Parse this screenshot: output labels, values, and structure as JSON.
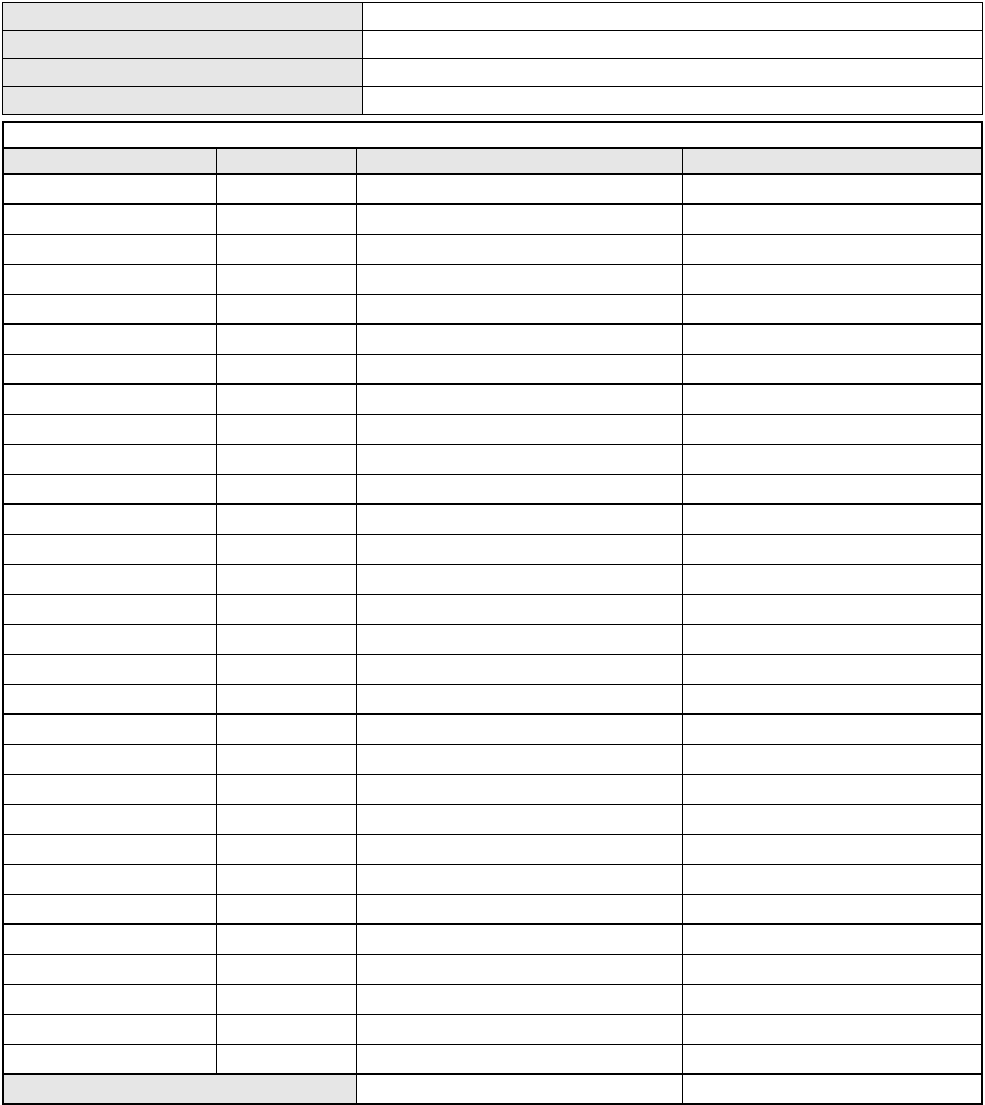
{
  "header": {
    "row1_label": "",
    "row1_value": "",
    "row2_label": "",
    "row2_value": "",
    "row3_label": "",
    "row3_value": "",
    "row4_label": "",
    "row4_value": ""
  },
  "main": {
    "title": "",
    "columns": {
      "col1": "",
      "col2": "",
      "col3": "",
      "col4": ""
    },
    "groups": [
      {
        "rows": [
          [
            "",
            "",
            "",
            ""
          ]
        ]
      },
      {
        "rows": [
          [
            "",
            "",
            "",
            ""
          ],
          [
            "",
            "",
            "",
            ""
          ],
          [
            "",
            "",
            "",
            ""
          ],
          [
            "",
            "",
            "",
            ""
          ]
        ]
      },
      {
        "rows": [
          [
            "",
            "",
            "",
            ""
          ],
          [
            "",
            "",
            "",
            ""
          ]
        ]
      },
      {
        "rows": [
          [
            "",
            "",
            "",
            ""
          ],
          [
            "",
            "",
            "",
            ""
          ],
          [
            "",
            "",
            "",
            ""
          ],
          [
            "",
            "",
            "",
            ""
          ]
        ]
      },
      {
        "rows": [
          [
            "",
            "",
            "",
            ""
          ],
          [
            "",
            "",
            "",
            ""
          ],
          [
            "",
            "",
            "",
            ""
          ],
          [
            "",
            "",
            "",
            ""
          ],
          [
            "",
            "",
            "",
            ""
          ],
          [
            "",
            "",
            "",
            ""
          ],
          [
            "",
            "",
            "",
            ""
          ]
        ]
      },
      {
        "rows": [
          [
            "",
            "",
            "",
            ""
          ],
          [
            "",
            "",
            "",
            ""
          ],
          [
            "",
            "",
            "",
            ""
          ],
          [
            "",
            "",
            "",
            ""
          ],
          [
            "",
            "",
            "",
            ""
          ],
          [
            "",
            "",
            "",
            ""
          ],
          [
            "",
            "",
            "",
            ""
          ]
        ]
      },
      {
        "rows": [
          [
            "",
            "",
            "",
            ""
          ],
          [
            "",
            "",
            "",
            ""
          ],
          [
            "",
            "",
            "",
            ""
          ],
          [
            "",
            "",
            "",
            ""
          ],
          [
            "",
            "",
            "",
            ""
          ]
        ]
      }
    ]
  },
  "footer": {
    "label": "",
    "value1": "",
    "value2": ""
  }
}
